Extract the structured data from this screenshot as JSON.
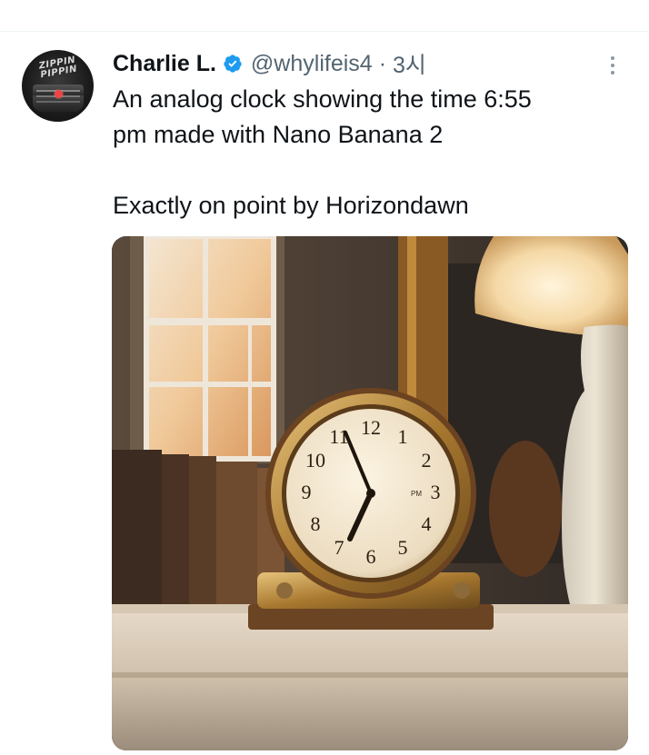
{
  "tweet": {
    "author": {
      "display_name": "Charlie L.",
      "handle": "@whylifeis4",
      "verified": true,
      "avatar_text": "ZIPPIN PIPPIN"
    },
    "separator": "·",
    "timestamp": "3시",
    "text_lines": [
      "An analog clock showing the time 6:55",
      "pm made with Nano Banana 2",
      "",
      "Exactly on point by Horizondawn"
    ],
    "media": {
      "clock_numerals": [
        "12",
        "1",
        "2",
        "3",
        "4",
        "5",
        "6",
        "7",
        "8",
        "9",
        "10",
        "11"
      ],
      "clock_label": "PM"
    }
  },
  "colors": {
    "verified_blue": "#1d9bf0",
    "secondary_text": "#536471",
    "primary_text": "#0f1419"
  },
  "icons": {
    "verified": "verified-badge-icon",
    "more": "more-options-icon"
  }
}
